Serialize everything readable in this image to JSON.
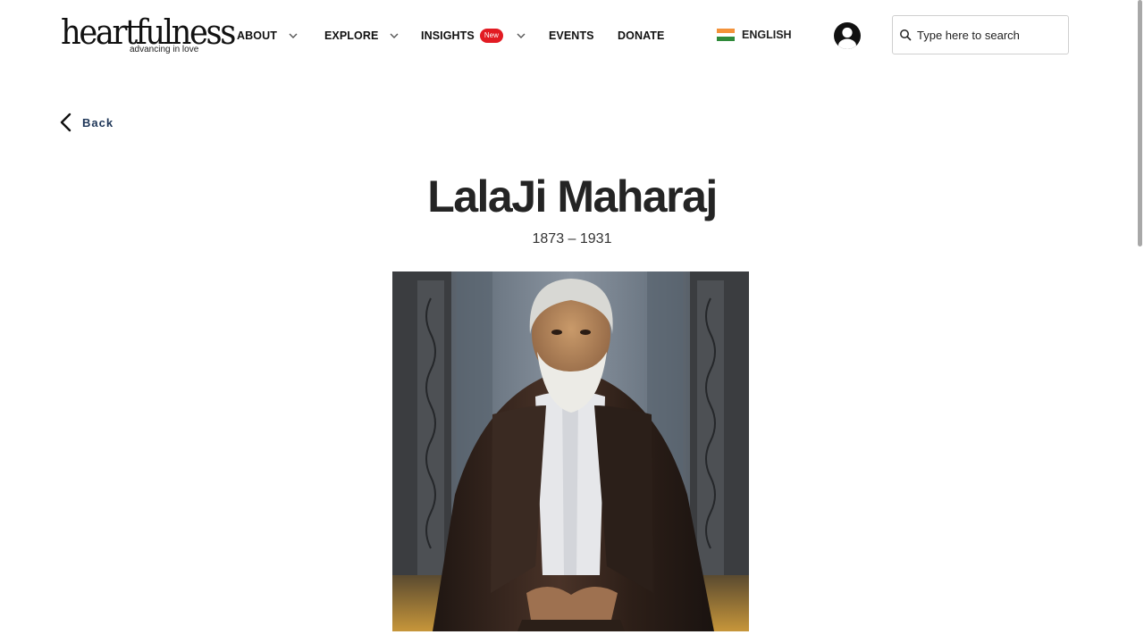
{
  "brand": {
    "name": "heartfulness",
    "tagline": "advancing in love"
  },
  "nav": {
    "about": "ABOUT",
    "explore": "EXPLORE",
    "insights": "INSIGHTS",
    "insights_badge": "New",
    "events": "EVENTS",
    "donate": "DONATE"
  },
  "language": {
    "label": "ENGLISH",
    "flag": "india-flag-icon"
  },
  "account": {
    "icon": "user-avatar-icon"
  },
  "search": {
    "placeholder": "Type here to search",
    "value": ""
  },
  "back": {
    "label": "Back"
  },
  "page": {
    "title": "LalaJi Maharaj",
    "dates": "1873 – 1931"
  },
  "portrait": {
    "subject": "portrait of LalaJi Maharaj seated in dark shawl"
  },
  "colors": {
    "badge": "#e21b23",
    "back_link": "#1d3557",
    "title": "#242424"
  }
}
